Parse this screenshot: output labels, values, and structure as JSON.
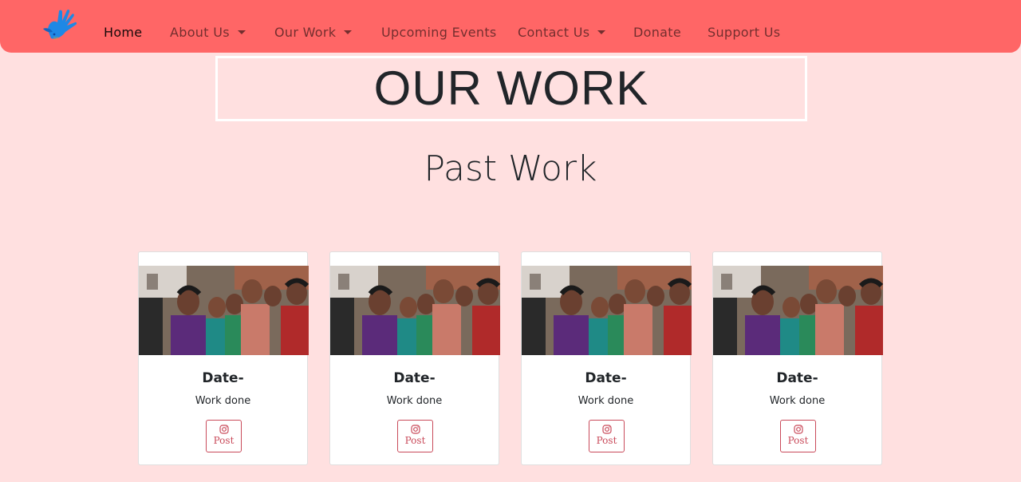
{
  "nav": {
    "items": [
      {
        "label": "Home",
        "dropdown": false,
        "active": true
      },
      {
        "label": "About Us",
        "dropdown": true,
        "active": false
      },
      {
        "label": "Our Work",
        "dropdown": true,
        "active": false
      },
      {
        "label": "Upcoming Events",
        "dropdown": false,
        "active": false
      },
      {
        "label": "Contact Us",
        "dropdown": true,
        "active": false
      },
      {
        "label": "Donate",
        "dropdown": false,
        "active": false
      },
      {
        "label": "Support Us",
        "dropdown": false,
        "active": false
      }
    ]
  },
  "banner": {
    "title": "OUR WORK"
  },
  "section": {
    "title": "Past Work"
  },
  "cards": [
    {
      "date": "Date-",
      "text": "Work done",
      "button": "Post"
    },
    {
      "date": "Date-",
      "text": "Work done",
      "button": "Post"
    },
    {
      "date": "Date-",
      "text": "Work done",
      "button": "Post"
    },
    {
      "date": "Date-",
      "text": "Work done",
      "button": "Post"
    }
  ],
  "colors": {
    "navbar": "#ff6666",
    "background": "#ffe0e0",
    "button_accent": "#c94a5a",
    "logo": "#1e88e5"
  },
  "icons": {
    "logo": "hand-dove-icon",
    "post": "instagram-icon"
  }
}
